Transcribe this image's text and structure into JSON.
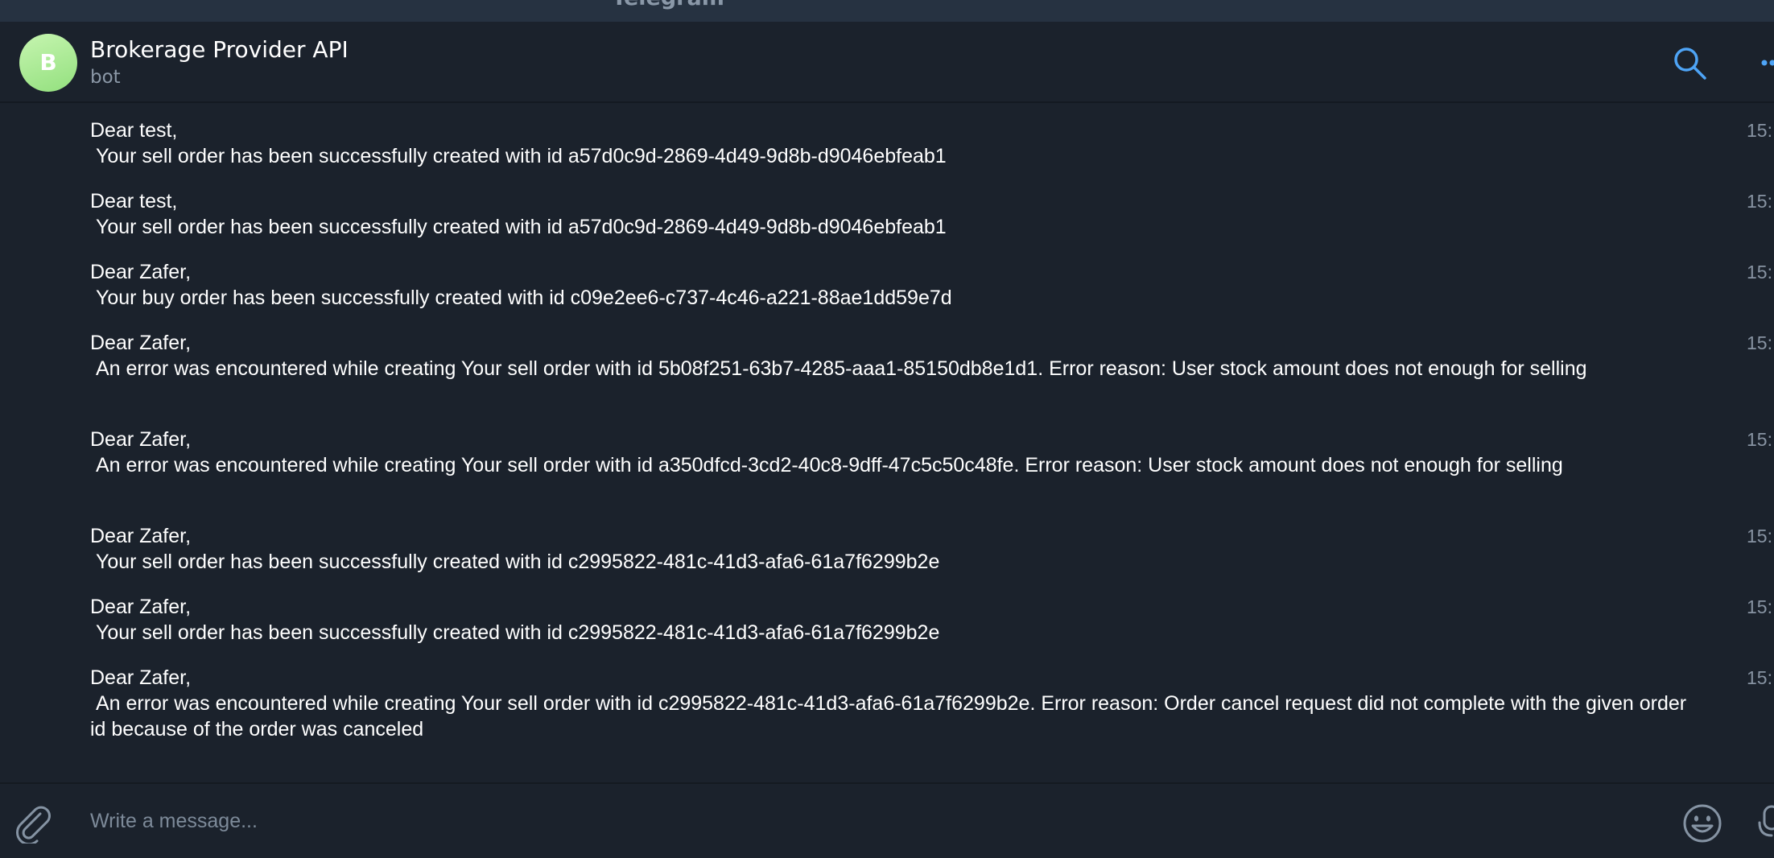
{
  "window": {
    "app_title": "Telegram"
  },
  "header": {
    "avatar_letter": "B",
    "chat_name": "Brokerage Provider API",
    "chat_status": "bot"
  },
  "icons": {
    "search": "search-icon",
    "more": "more-vertical-icon",
    "attach": "paperclip-icon",
    "emoji": "smiley-icon",
    "mic": "microphone-icon"
  },
  "colors": {
    "background": "#1b222c",
    "titlebar": "#263241",
    "accent": "#4ea4f6",
    "avatar_gradient_start": "#c6f5b0",
    "avatar_gradient_end": "#93e07e",
    "text_primary": "#ffffff",
    "text_secondary": "#8b98a7"
  },
  "messages": [
    {
      "text": "Dear test,\n Your sell order has been successfully created with id a57d0c9d-2869-4d49-9d8b-d9046ebfeab1",
      "time": "15:"
    },
    {
      "text": "Dear test,\n Your sell order has been successfully created with id a57d0c9d-2869-4d49-9d8b-d9046ebfeab1",
      "time": "15:"
    },
    {
      "text": "Dear Zafer,\n Your buy order has been successfully created with id c09e2ee6-c737-4c46-a221-88ae1dd59e7d",
      "time": "15:"
    },
    {
      "text": "Dear Zafer,\n An error was encountered while creating Your sell order with id 5b08f251-63b7-4285-aaa1-85150db8e1d1. Error reason: User stock amount does not enough for selling",
      "time": "15:"
    },
    {
      "text": "Dear Zafer,\n An error was encountered while creating Your sell order with id a350dfcd-3cd2-40c8-9dff-47c5c50c48fe. Error reason: User stock amount does not enough for selling",
      "time": "15:"
    },
    {
      "text": "Dear Zafer,\n Your sell order has been successfully created with id c2995822-481c-41d3-afa6-61a7f6299b2e",
      "time": "15:"
    },
    {
      "text": "Dear Zafer,\n Your sell order has been successfully created with id c2995822-481c-41d3-afa6-61a7f6299b2e",
      "time": "15:"
    },
    {
      "text": "Dear Zafer,\n An error was encountered while creating Your sell order with id c2995822-481c-41d3-afa6-61a7f6299b2e. Error reason: Order cancel request did not complete with the given order id because of the order was canceled",
      "time": "15:"
    }
  ],
  "composer": {
    "placeholder": "Write a message..."
  }
}
